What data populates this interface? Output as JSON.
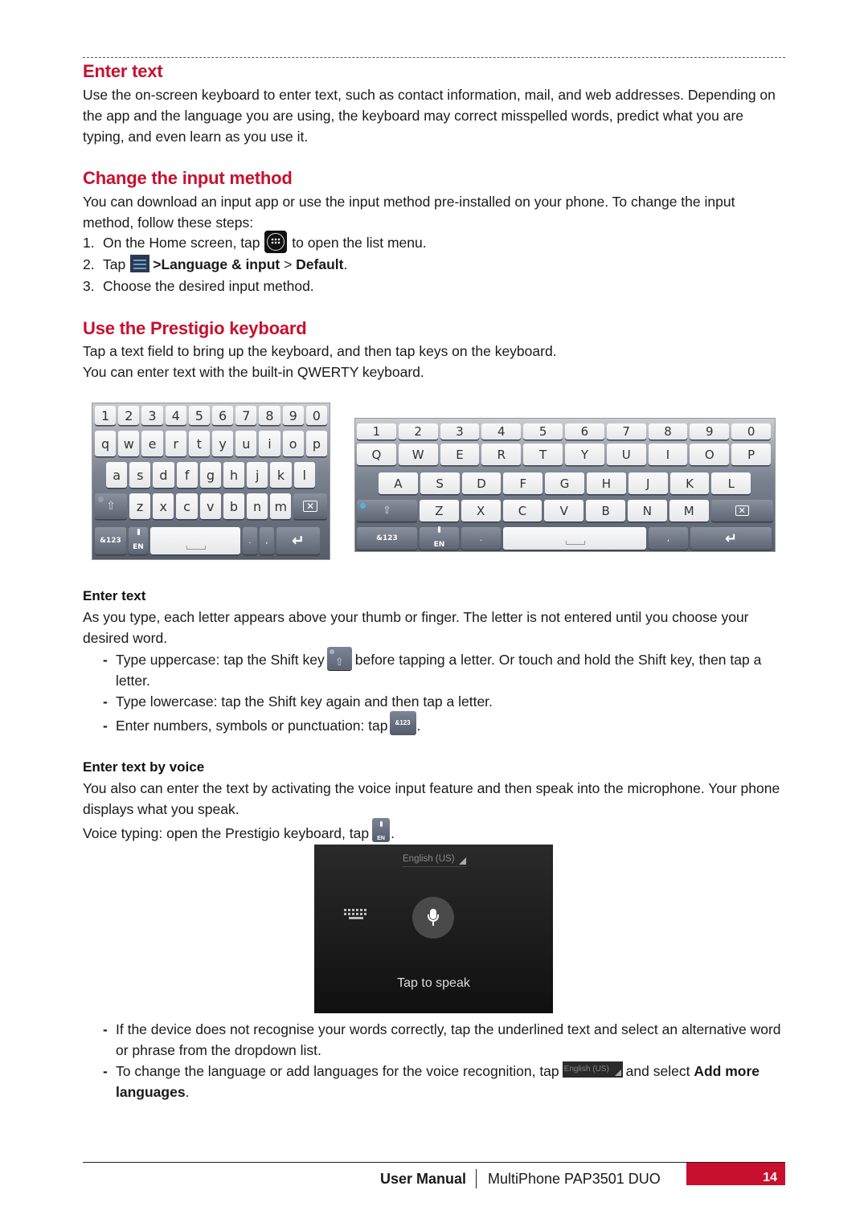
{
  "sections": {
    "enter_text": {
      "title": "Enter text",
      "body": "Use the on-screen keyboard to enter text, such as contact information, mail, and web addresses. Depending on the app and the language you are using, the keyboard may correct misspelled words, predict what you are typing, and even learn as you use it."
    },
    "change_input": {
      "title": "Change the input method",
      "body": "You can download an input app or use the input method pre-installed on your phone. To change the input method, follow these steps:",
      "steps": [
        {
          "num": "1.",
          "before": "On the Home screen, tap",
          "icon": "apps-grid-icon",
          "after": "to open the list menu."
        },
        {
          "num": "2.",
          "before": "Tap",
          "icon": "settings-icon",
          "bold1": ">Language & input",
          "mid": " > ",
          "bold2": "Default",
          "after": "."
        },
        {
          "num": "3.",
          "text": "Choose the desired input method."
        }
      ]
    },
    "prestigio_keyboard": {
      "title": "Use the Prestigio keyboard",
      "line1": "Tap a text field to bring up the keyboard, and then tap keys on the keyboard.",
      "line2": "You can enter text with the built-in QWERTY keyboard."
    },
    "enter_text_sub": {
      "title": "Enter text",
      "body": "As you type, each letter appears above your thumb or finger. The letter is not entered until you choose your desired word.",
      "bullets": [
        {
          "before": "Type uppercase: tap the Shift key",
          "icon": "shift-key-icon",
          "after": "before tapping a letter. Or touch and hold the Shift key, then tap a letter."
        },
        {
          "text": "Type lowercase: tap the Shift key again and then tap a letter."
        },
        {
          "before": "Enter numbers, symbols or punctuation: tap",
          "icon": "symbols-key-icon",
          "icon_label": "&123",
          "after": "."
        }
      ]
    },
    "enter_voice": {
      "title": "Enter text by voice",
      "body": "You also can enter the text by activating the voice input feature and then speak into the microphone. Your phone displays what you speak.",
      "voice_line_before": "Voice typing: open the Prestigio keyboard, tap",
      "voice_icon_label": "EN",
      "voice_line_after": ".",
      "bullets": [
        {
          "text": "If the device does not recognise your words correctly, tap the underlined text and select an alternative word or phrase from the dropdown list."
        },
        {
          "before": "To change the language or add languages for the voice recognition, tap",
          "icon_label": "English (US)",
          "after": "and select",
          "bold": "Add more languages",
          "end": "."
        }
      ]
    }
  },
  "keyboard_portrait": {
    "numbers": [
      "1",
      "2",
      "3",
      "4",
      "5",
      "6",
      "7",
      "8",
      "9",
      "0"
    ],
    "row1": [
      "q",
      "w",
      "e",
      "r",
      "t",
      "y",
      "u",
      "i",
      "o",
      "p"
    ],
    "row2": [
      "a",
      "s",
      "d",
      "f",
      "g",
      "h",
      "j",
      "k",
      "l"
    ],
    "row3": [
      "z",
      "x",
      "c",
      "v",
      "b",
      "n",
      "m"
    ],
    "symbols_label": "&123",
    "lang_label": "EN",
    "period": ".",
    "comma": ","
  },
  "keyboard_landscape": {
    "numbers": [
      "1",
      "2",
      "3",
      "4",
      "5",
      "6",
      "7",
      "8",
      "9",
      "0"
    ],
    "row1": [
      "Q",
      "W",
      "E",
      "R",
      "T",
      "Y",
      "U",
      "I",
      "O",
      "P"
    ],
    "row2": [
      "A",
      "S",
      "D",
      "F",
      "G",
      "H",
      "J",
      "K",
      "L"
    ],
    "row3": [
      "Z",
      "X",
      "C",
      "V",
      "B",
      "N",
      "M"
    ],
    "symbols_label": "&123",
    "lang_label": "EN",
    "period": ".",
    "comma": ","
  },
  "voice_panel": {
    "language": "English (US)",
    "prompt": "Tap to speak"
  },
  "footer": {
    "manual": "User Manual",
    "product": "MultiPhone PAP3501 DUO",
    "page": "14"
  },
  "colors": {
    "heading": "#c8102e",
    "page_box": "#c8102e",
    "shift_indicator": "#4fb3e8"
  }
}
